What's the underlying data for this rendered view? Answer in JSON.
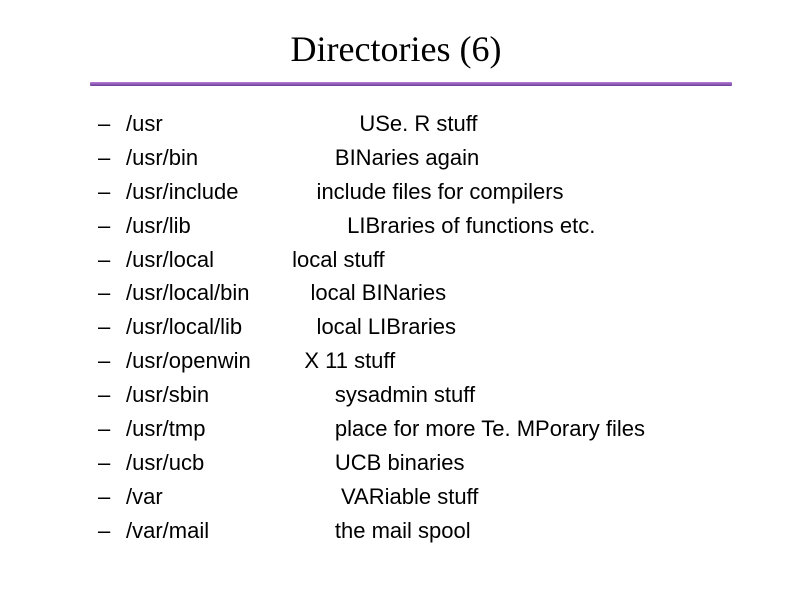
{
  "title": "Directories (6)",
  "items": [
    {
      "path": "/usr",
      "desc": "            USe. R stuff"
    },
    {
      "path": "/usr/bin",
      "desc": "        BINaries again"
    },
    {
      "path": "/usr/include",
      "desc": "     include files for compilers"
    },
    {
      "path": "/usr/lib",
      "desc": "          LIBraries of functions etc."
    },
    {
      "path": "/usr/local",
      "desc": " local stuff"
    },
    {
      "path": "/usr/local/bin",
      "desc": "    local BINaries"
    },
    {
      "path": "/usr/local/lib",
      "desc": "     local LIBraries"
    },
    {
      "path": "/usr/openwin",
      "desc": "   X 11 stuff"
    },
    {
      "path": "/usr/sbin",
      "desc": "        sysadmin stuff"
    },
    {
      "path": "/usr/tmp",
      "desc": "        place for more Te. MPorary files"
    },
    {
      "path": "/usr/ucb",
      "desc": "        UCB binaries"
    },
    {
      "path": "/var",
      "desc": "         VARiable stuff"
    },
    {
      "path": "/var/mail",
      "desc": "        the mail spool"
    }
  ]
}
